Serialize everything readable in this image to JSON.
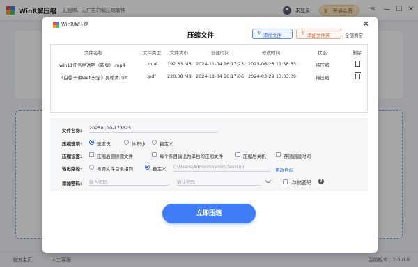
{
  "app": {
    "name": "WinR解压缩",
    "slogan": "无捆绑、无广告的解压缩软件",
    "login_text": "未登录",
    "vip_label": "开通会员",
    "vip_icon": "crown-icon",
    "bottom_links": [
      "官方主页",
      "人工客服"
    ],
    "version": "当前版本：2.0.0.8",
    "colors": {
      "accent": "#3f7cf6",
      "vip": "#fde9c4",
      "logo": [
        "#e74c3c",
        "#3f7cf6",
        "#f5a623",
        "#2ecc71"
      ]
    }
  },
  "dialog": {
    "title": "WinR解压缩",
    "heading": "压缩文件",
    "add_file_label": "添加文件",
    "add_folder_label": "添加文件夹",
    "clear_label": "全部清空",
    "table": {
      "headers": [
        "文件名称",
        "文件类型",
        "文件大小",
        "创建时间",
        "修改时间",
        "状态",
        "删除"
      ],
      "rows": [
        {
          "name": "win11任务栏透明（新版）.mp4",
          "type": ".mp4",
          "size": "192.33 MB",
          "created": "2024-11-04 16:17:23",
          "modified": "2023-06-28 11:58:33",
          "status": "待压缩"
        },
        {
          "name": "《白帽子讲Web安全》吴翰清.pdf",
          "type": ".pdf",
          "size": "220.08 MB",
          "created": "2024-11-04 16:17:06",
          "modified": "2024-03-29 13:33:09",
          "status": "待压缩"
        }
      ]
    },
    "settings": {
      "filename_label": "文件名称:",
      "filename_value": "20250110-173325",
      "compress_option_label": "压缩选项:",
      "compress_options": [
        "速度快",
        "体积小",
        "自定义"
      ],
      "compress_selected": "速度快",
      "compress_settings_label": "压缩设置:",
      "compress_settings": [
        "压缩后删除源文件",
        "每个条目输出为单独的压缩文件",
        "压缩后关机",
        "存储创建时间"
      ],
      "output_label": "输出路径:",
      "output_options": [
        "与源文件目录相同",
        "自定义"
      ],
      "output_selected": "自定义",
      "output_path": "C:\\Users\\Administrator\\Desktop",
      "change_dir_label": "更改目标",
      "password_label": "添加密码:",
      "password_placeholder": "输入密码",
      "confirm_placeholder": "确认密码",
      "save_password_label": "存储密码"
    },
    "compress_button": "立即压缩"
  }
}
